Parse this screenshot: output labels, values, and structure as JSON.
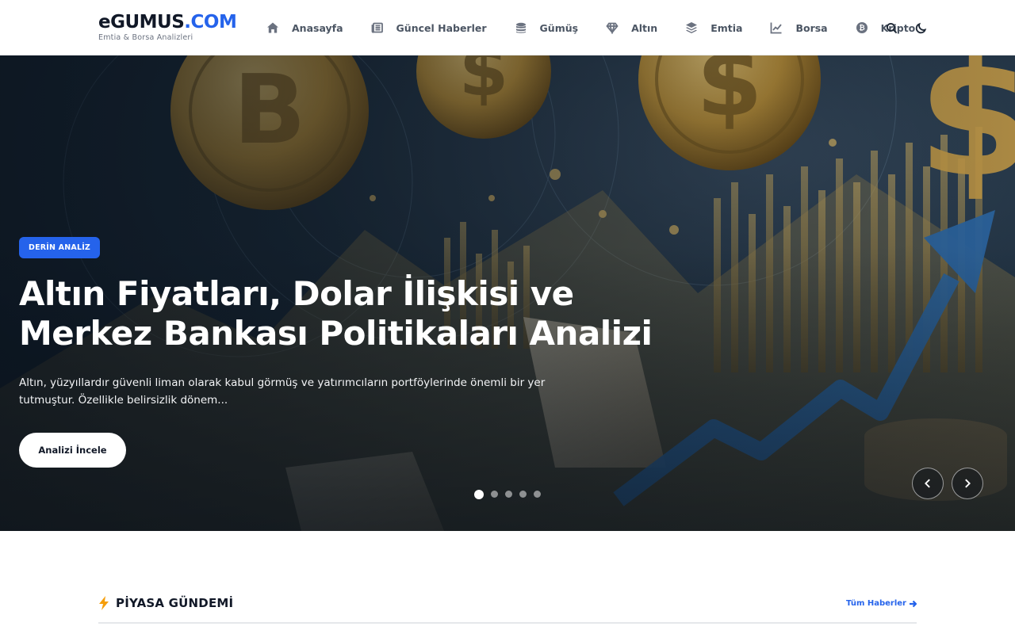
{
  "header": {
    "logo_main": "eGUMUS",
    "logo_accent": ".COM",
    "logo_tagline": "Emtia & Borsa Analizleri",
    "nav": [
      {
        "label": "Anasayfa",
        "icon": "home-icon"
      },
      {
        "label": "Güncel Haberler",
        "icon": "newspaper-icon"
      },
      {
        "label": "Gümüş",
        "icon": "coins-icon"
      },
      {
        "label": "Altın",
        "icon": "gem-icon"
      },
      {
        "label": "Emtia",
        "icon": "layers-icon"
      },
      {
        "label": "Borsa",
        "icon": "chart-line-icon"
      },
      {
        "label": "Kripto",
        "icon": "bitcoin-icon"
      }
    ],
    "tools": [
      {
        "icon": "search-icon"
      },
      {
        "icon": "moon-icon"
      }
    ]
  },
  "hero": {
    "badge": "DERİN ANALİZ",
    "title": "Altın Fiyatları, Dolar İlişkisi ve Merkez Bankası Politikaları Analizi",
    "description": "Altın, yüzyıllardır güvenli liman olarak kabul görmüş ve yatırımcıların portföylerinde önemli bir yer tutmuştur. Özellikle belirsizlik dönem...",
    "cta_label": "Analizi İncele",
    "slides_total": 5,
    "slide_active": 1,
    "prev_icon": "chevron-left-icon",
    "next_icon": "chevron-right-icon"
  },
  "section": {
    "title": "PİYASA GÜNDEMİ",
    "title_icon": "bolt-icon",
    "see_all": "Tüm Haberler",
    "see_all_icon": "arrow-right-icon"
  },
  "colors": {
    "brand": "#2563eb",
    "accent_bolt": "#f59e0b",
    "text_dark": "#111827",
    "nav_text": "#4b5563"
  }
}
